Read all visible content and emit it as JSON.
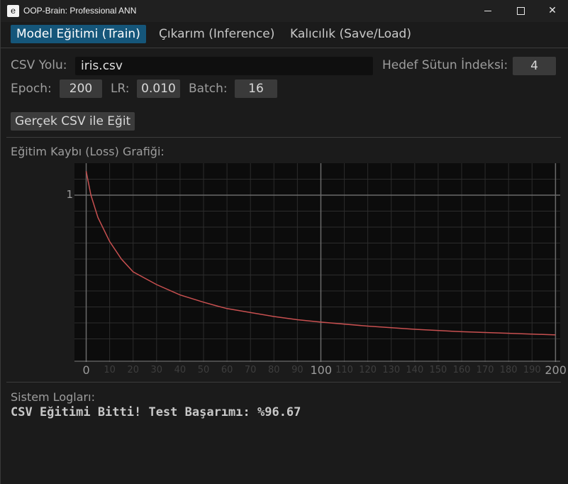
{
  "window": {
    "icon": "e",
    "title": "OOP-Brain: Professional ANN"
  },
  "menu": {
    "items": [
      "Model Eğitimi (Train)",
      "Çıkarım (Inference)",
      "Kalıcılık (Save/Load)"
    ],
    "active_index": 0
  },
  "form": {
    "csv_label": "CSV Yolu:",
    "csv_value": "iris.csv",
    "target_label": "Hedef Sütun İndeksi:",
    "target_value": "4",
    "epoch_label": "Epoch:",
    "epoch_value": "200",
    "lr_label": "LR:",
    "lr_value": "0.010",
    "batch_label": "Batch:",
    "batch_value": "16",
    "train_button": "Gerçek CSV ile Eğit"
  },
  "chart_section": {
    "label": "Eğitim Kaybı (Loss) Grafiği:"
  },
  "chart_data": {
    "type": "line",
    "xlabel": "",
    "ylabel": "",
    "xlim": [
      -5,
      202
    ],
    "ylim": [
      0,
      1.2
    ],
    "grid": true,
    "x_ticks_major": [
      0,
      100,
      200
    ],
    "x_ticks_minor": [
      10,
      20,
      30,
      40,
      50,
      60,
      70,
      80,
      90,
      110,
      120,
      130,
      140,
      150,
      160,
      170,
      180,
      190
    ],
    "y_ticks_major": [
      1
    ],
    "series": [
      {
        "color": "#c85050",
        "x": [
          0,
          2,
          5,
          10,
          15,
          20,
          30,
          40,
          50,
          56,
          60,
          70,
          80,
          90,
          100,
          120,
          140,
          160,
          180,
          200
        ],
        "y": [
          1.15,
          1.0,
          0.86,
          0.71,
          0.6,
          0.52,
          0.44,
          0.375,
          0.33,
          0.305,
          0.29,
          0.265,
          0.24,
          0.22,
          0.205,
          0.18,
          0.16,
          0.145,
          0.135,
          0.125
        ]
      }
    ]
  },
  "logs": {
    "label": "Sistem Logları:",
    "message": "CSV Eğitimi Bitti! Test Başarımı: %96.67"
  }
}
